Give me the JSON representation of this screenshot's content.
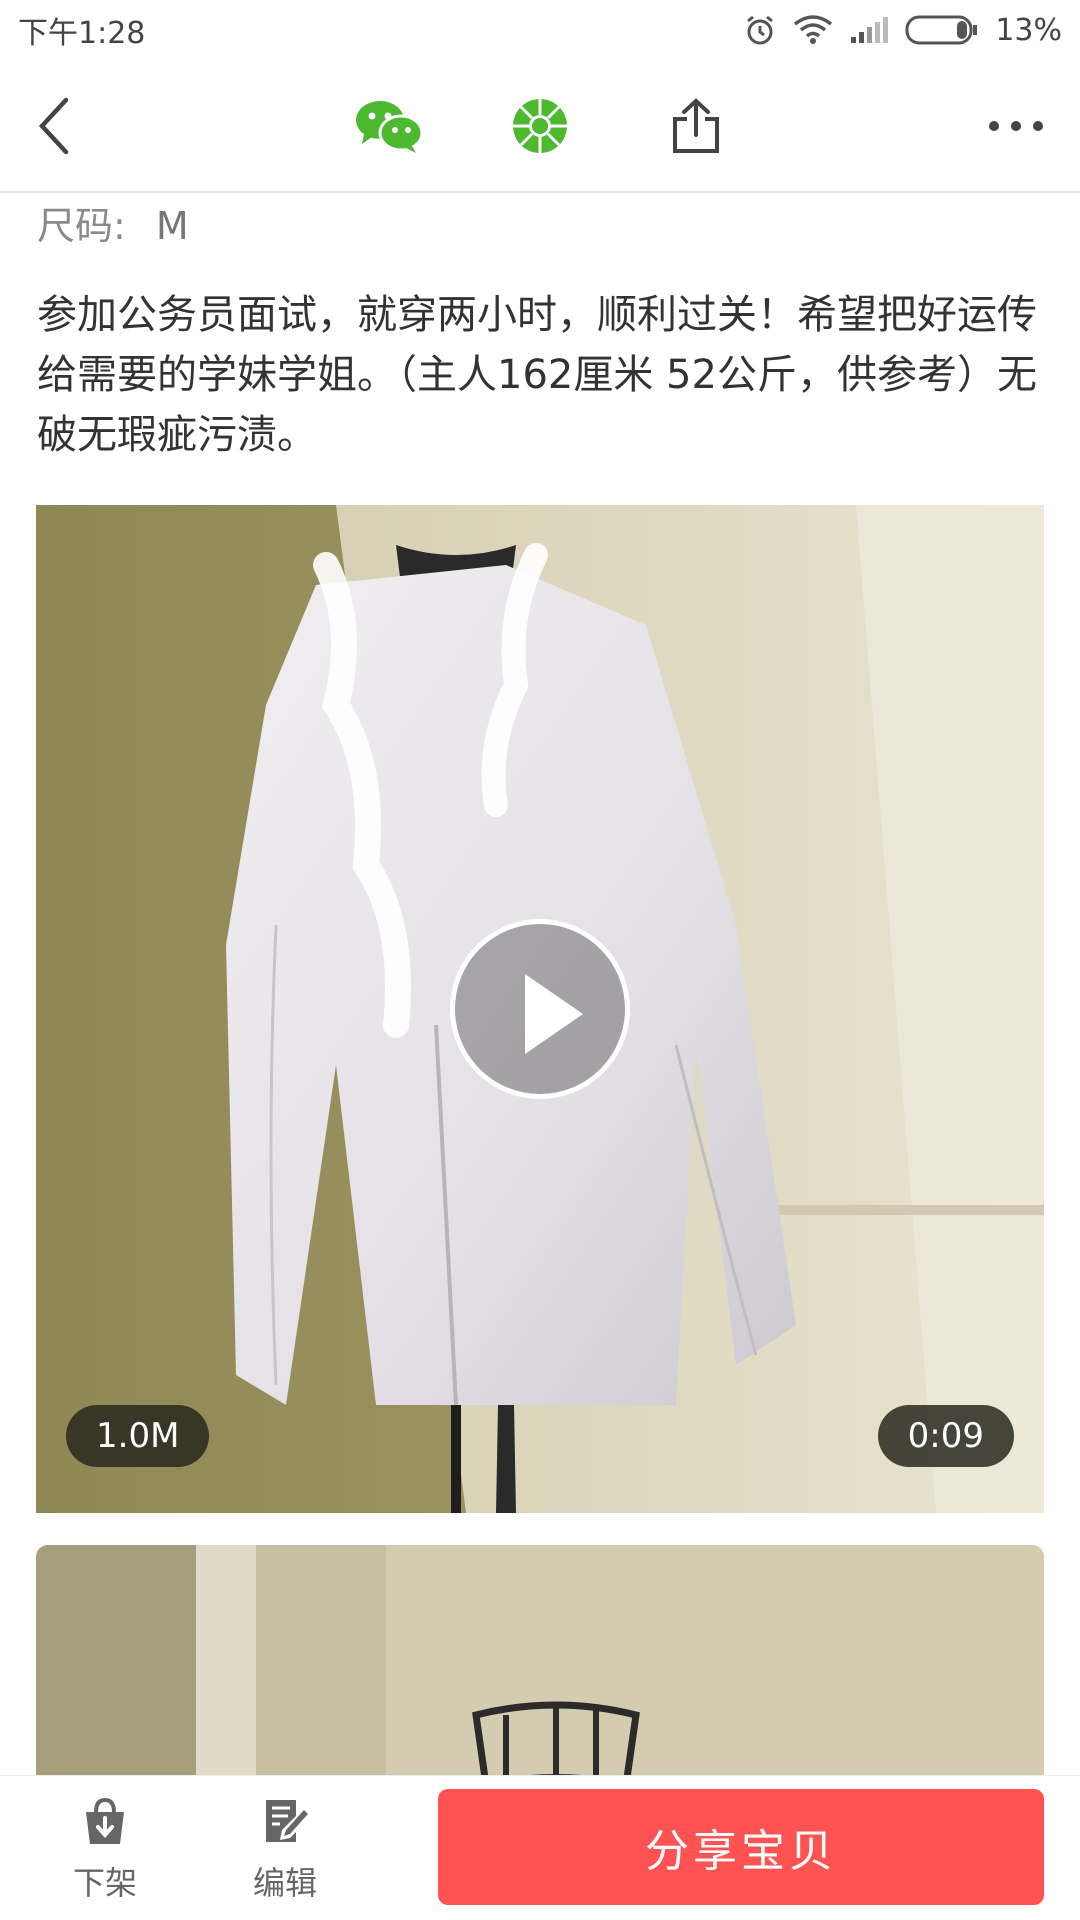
{
  "status_bar": {
    "time": "下午1:28",
    "battery": "13%"
  },
  "nav": {
    "icons": [
      "back-icon",
      "wechat-icon",
      "moments-icon",
      "share-upload-icon",
      "more-icon"
    ],
    "brand_color": "#4cb92e"
  },
  "item": {
    "size_label": "尺码:",
    "size_value": "M",
    "description": "参加公务员面试，就穿两小时，顺利过关！希望把好运传给需要的学妹学姐。（主人162厘米  52公斤，供参考）无破无瑕疵污渍。"
  },
  "video": {
    "file_size": "1.0M",
    "duration": "0:09"
  },
  "bottom_bar": {
    "delist_label": "下架",
    "edit_label": "编辑",
    "share_label": "分享宝贝",
    "share_color": "#ff5252"
  }
}
